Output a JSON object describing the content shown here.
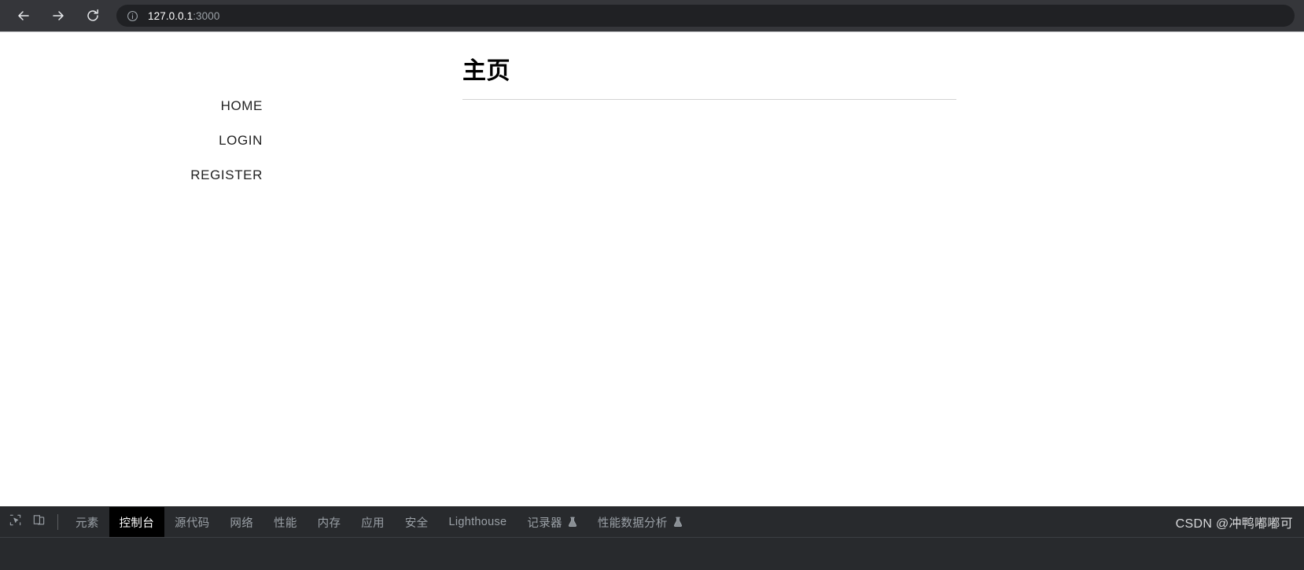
{
  "browser": {
    "back_label": "back-arrow",
    "forward_label": "forward-arrow",
    "reload_label": "reload",
    "url_host": "127.0.0.1",
    "url_port": ":3000",
    "site_info_icon": "info-circle-icon"
  },
  "page": {
    "title": "主页",
    "nav": [
      {
        "label": "HOME"
      },
      {
        "label": "LOGIN"
      },
      {
        "label": "REGISTER"
      }
    ]
  },
  "devtools": {
    "inspect_icon": "inspect-element-icon",
    "device_icon": "device-toolbar-icon",
    "tabs": [
      {
        "label": "元素",
        "active": false,
        "experimental": false
      },
      {
        "label": "控制台",
        "active": true,
        "experimental": false
      },
      {
        "label": "源代码",
        "active": false,
        "experimental": false
      },
      {
        "label": "网络",
        "active": false,
        "experimental": false
      },
      {
        "label": "性能",
        "active": false,
        "experimental": false
      },
      {
        "label": "内存",
        "active": false,
        "experimental": false
      },
      {
        "label": "应用",
        "active": false,
        "experimental": false
      },
      {
        "label": "安全",
        "active": false,
        "experimental": false
      },
      {
        "label": "Lighthouse",
        "active": false,
        "experimental": false
      },
      {
        "label": "记录器",
        "active": false,
        "experimental": true
      },
      {
        "label": "性能数据分析",
        "active": false,
        "experimental": true
      }
    ],
    "watermark": "CSDN @冲鸭嘟嘟可"
  },
  "colors": {
    "toolbar_bg": "#35363a",
    "omnibox_bg": "#202124",
    "devtools_bg": "#282a2d",
    "active_tab_bg": "#000000",
    "page_bg": "#ffffff",
    "text_muted": "#9aa0a6"
  }
}
